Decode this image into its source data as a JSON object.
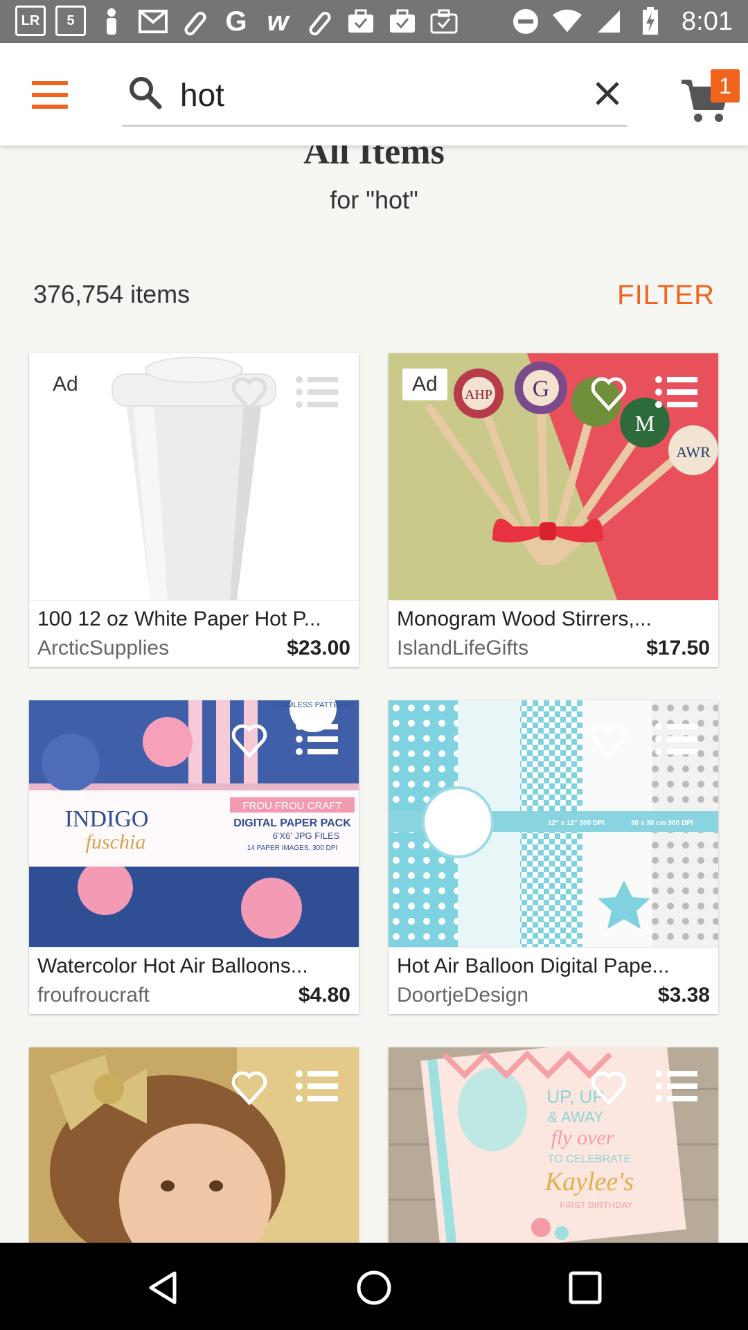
{
  "status_bar": {
    "time": "8:01",
    "icons": [
      "lr-icon",
      "5-icon",
      "person-icon",
      "gmail-icon",
      "link-icon",
      "google-icon",
      "w-icon",
      "link-icon",
      "briefcase-icon",
      "briefcase-icon",
      "briefcase-icon"
    ],
    "left_labels": [
      "LR",
      "5",
      "",
      "",
      "",
      "G",
      "w",
      "",
      "",
      "",
      ""
    ]
  },
  "search": {
    "query": "hot",
    "placeholder": ""
  },
  "cart": {
    "count": "1"
  },
  "heading": {
    "title": "All Items",
    "subtitle": "for \"hot\""
  },
  "results": {
    "count_label": "376,754 items",
    "filter_label": "FILTER"
  },
  "products": [
    {
      "title": "100 12 oz White Paper Hot P...",
      "shop": "ArcticSupplies",
      "price": "$23.00",
      "ad": "Ad"
    },
    {
      "title": "Monogram Wood Stirrers,...",
      "shop": "IslandLifeGifts",
      "price": "$17.50",
      "ad": "Ad"
    },
    {
      "title": "Watercolor Hot Air Balloons...",
      "shop": "froufroucraft",
      "price": "$4.80",
      "ad": ""
    },
    {
      "title": "Hot Air Balloon Digital Pape...",
      "shop": "DoortjeDesign",
      "price": "$3.38",
      "ad": ""
    },
    {
      "title": "",
      "shop": "",
      "price": "",
      "ad": ""
    },
    {
      "title": "",
      "shop": "",
      "price": "",
      "ad": ""
    }
  ],
  "thumb_text": {
    "p3_brand": "FROU FROU CRAFT",
    "p3_pack": "DIGITAL PAPER PACK",
    "p3_files": "6'X6' JPG FILES",
    "p3_images": "14 PAPER IMAGES, 300 DPI",
    "p3_name1": "INDIGO",
    "p3_name2": "fuschia",
    "p3_seamless": "SEAMLESS PATTERNS",
    "p4_dims1": "12\" x 12\" 300 DPI",
    "p4_dims2": "30 x 30 cm 300 DPI",
    "p6_line1": "UP, UP",
    "p6_line2": "& AWAY",
    "p6_line3": "fly over",
    "p6_line4": "TO CELEBRATE",
    "p6_line5": "Kaylee's",
    "p6_line6": "FIRST BIRTHDAY",
    "p2_letters": [
      "AHP",
      "G",
      "M",
      "AWR"
    ]
  },
  "colors": {
    "accent": "#f1641e",
    "status_bar": "#757575",
    "nav_bar": "#000000"
  }
}
